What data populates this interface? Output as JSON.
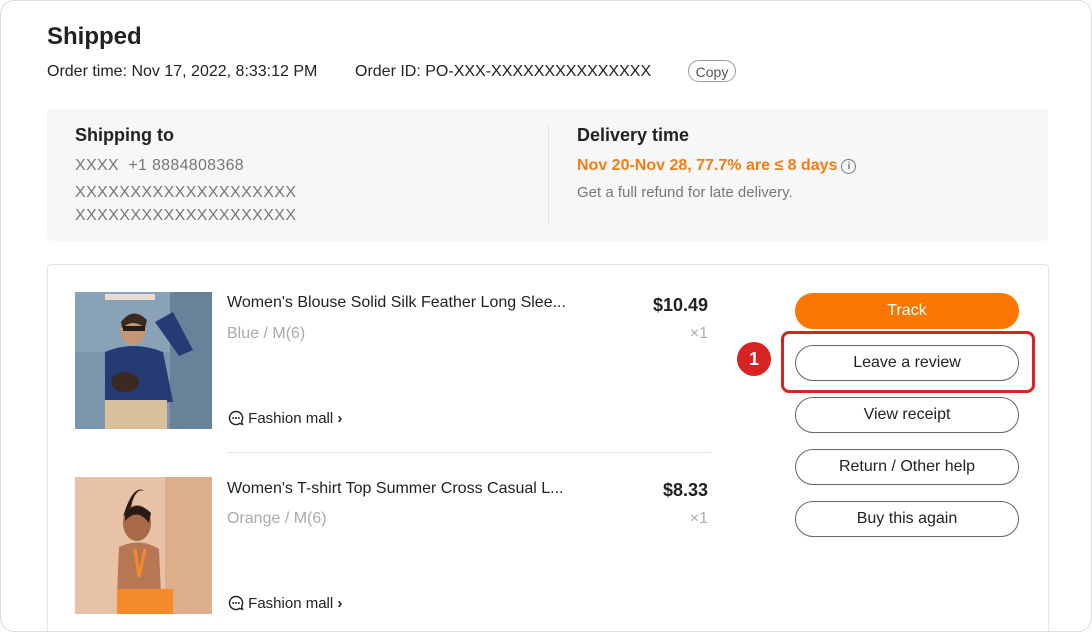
{
  "order": {
    "status": "Shipped",
    "order_time_label": "Order time:",
    "order_time_value": "Nov 17, 2022, 8:33:12 PM",
    "order_id_label": "Order ID:",
    "order_id_value": "PO-XXX-XXXXXXXXXXXXXXX",
    "copy_label": "Copy"
  },
  "shipping": {
    "heading": "Shipping to",
    "name": "XXXX",
    "phone": "+1 8884808368",
    "address_line1": "XXXXXXXXXXXXXXXXXXXX",
    "address_line2": "XXXXXXXXXXXXXXXXXXXX"
  },
  "delivery": {
    "heading": "Delivery time",
    "estimate": "Nov 20-Nov 28, 77.7% are ≤ 8 days",
    "info_icon": "info-icon",
    "note": "Get a full refund for late delivery."
  },
  "items": [
    {
      "name": "Women's Blouse Solid Silk Feather Long Slee...",
      "variant": "Blue / M(6)",
      "price": "$10.49",
      "qty": "×1",
      "store": "Fashion mall",
      "store_chevron": "›"
    },
    {
      "name": "Women's T-shirt Top Summer Cross Casual L...",
      "variant": "Orange / M(6)",
      "price": "$8.33",
      "qty": "×1",
      "store": "Fashion mall",
      "store_chevron": "›"
    }
  ],
  "actions": {
    "track": "Track",
    "review": "Leave a review",
    "receipt": "View receipt",
    "return_help": "Return / Other help",
    "buy_again": "Buy this again"
  },
  "annotation": {
    "marker": "1",
    "color": "#d92323"
  },
  "colors": {
    "accent": "#fb7701",
    "delivery_text": "#f47c12"
  }
}
